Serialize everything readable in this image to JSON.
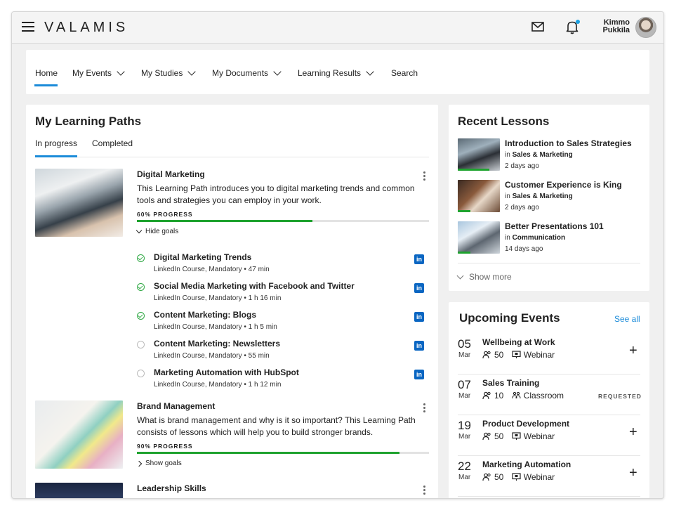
{
  "app": {
    "logo": "VALAMIS",
    "user_name_first": "Kimmo",
    "user_name_last": "Pukkila"
  },
  "nav": {
    "items": [
      "Home",
      "My Events",
      "My Studies",
      "My Documents",
      "Learning Results",
      "Search"
    ],
    "active": "Home"
  },
  "learning_paths": {
    "title": "My Learning Paths",
    "tabs": [
      "In progress",
      "Completed"
    ],
    "active_tab": "In progress",
    "paths": [
      {
        "title": "Digital Marketing",
        "description": "This Learning Path introduces you to digital marketing trends and common tools and strategies you can employ in your work.",
        "progress_label": "60% PROGRESS",
        "progress": 0.6,
        "goal_toggle": "Hide goals",
        "goals": [
          {
            "title": "Digital Marketing Trends",
            "meta": "LinkedIn Course, Mandatory • 47 min",
            "done": true
          },
          {
            "title": "Social Media Marketing with Facebook and Twitter",
            "meta": "LinkedIn Course, Mandatory • 1 h 16 min",
            "done": true
          },
          {
            "title": "Content Marketing: Blogs",
            "meta": "LinkedIn Course, Mandatory • 1 h 5 min",
            "done": true
          },
          {
            "title": "Content Marketing: Newsletters",
            "meta": "LinkedIn Course, Mandatory • 55 min",
            "done": false
          },
          {
            "title": "Marketing Automation with HubSpot",
            "meta": "LinkedIn Course, Mandatory • 1 h 12 min",
            "done": false
          }
        ]
      },
      {
        "title": "Brand Management",
        "description": "What is brand management and why is it so important? This Learning Path consists of lessons which will help you to build stronger brands.",
        "progress_label": "90% PROGRESS",
        "progress": 0.9,
        "goal_toggle": "Show goals"
      },
      {
        "title": "Leadership Skills"
      }
    ]
  },
  "recent_lessons": {
    "title": "Recent Lessons",
    "in_label": "in",
    "items": [
      {
        "title": "Introduction to Sales Strategies",
        "category": "Sales & Marketing",
        "date": "2 days ago",
        "progress": 0.75
      },
      {
        "title": "Customer Experience is King",
        "category": "Sales & Marketing",
        "date": "2 days ago",
        "progress": 0.3
      },
      {
        "title": "Better Presentations 101",
        "category": "Communication",
        "date": "14 days ago",
        "progress": 0.3
      }
    ],
    "show_more": "Show more"
  },
  "events": {
    "title": "Upcoming Events",
    "see_all": "See all",
    "items": [
      {
        "day": "05",
        "month": "Mar",
        "title": "Wellbeing at Work",
        "seats": "50",
        "type": "Webinar",
        "action": "+"
      },
      {
        "day": "07",
        "month": "Mar",
        "title": "Sales Training",
        "seats": "10",
        "type": "Classroom",
        "status": "REQUESTED"
      },
      {
        "day": "19",
        "month": "Mar",
        "title": "Product Development",
        "seats": "50",
        "type": "Webinar",
        "action": "+"
      },
      {
        "day": "22",
        "month": "Mar",
        "title": "Marketing Automation",
        "seats": "50",
        "type": "Webinar",
        "action": "+"
      }
    ]
  },
  "colors": {
    "accent": "#1b8bd9",
    "progress": "#1fa32f",
    "linkedin": "#0a66c2"
  },
  "icons": {
    "menu": "hamburger-icon",
    "mail": "mail-icon",
    "notifications": "bell-icon",
    "linkedin": "linkedin-icon",
    "seats": "people-icon",
    "webinar": "monitor-icon",
    "classroom": "classroom-icon"
  }
}
